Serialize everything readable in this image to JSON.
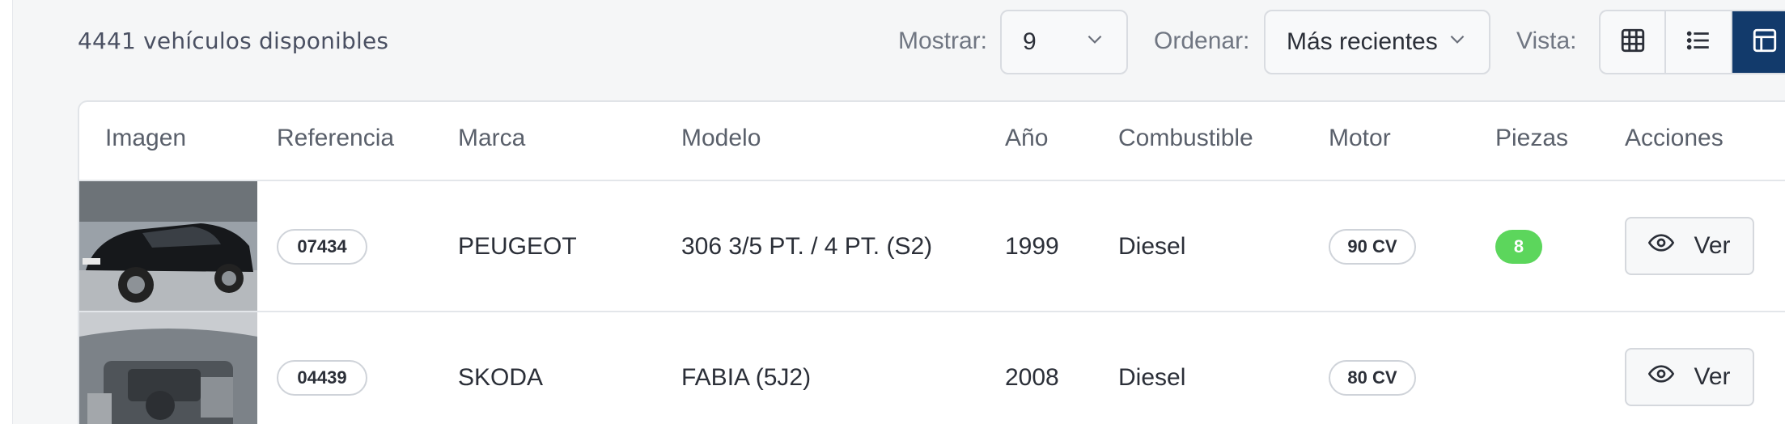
{
  "summary": {
    "count_text": "4441 vehículos disponibles"
  },
  "controls": {
    "show_label": "Mostrar:",
    "show_value": "9",
    "sort_label": "Ordenar:",
    "sort_value": "Más recientes",
    "view_label": "Vista:",
    "view_modes": [
      "grid-icon",
      "list-icon",
      "table-icon"
    ],
    "active_view": "table"
  },
  "table": {
    "headers": [
      "Imagen",
      "Referencia",
      "Marca",
      "Modelo",
      "Año",
      "Combustible",
      "Motor",
      "Piezas",
      "Acciones"
    ],
    "rows": [
      {
        "ref": "07434",
        "brand": "PEUGEOT",
        "model": "306 3/5 PT. / 4 PT. (S2)",
        "year": "1999",
        "fuel": "Diesel",
        "engine": "90 CV",
        "parts": "8",
        "action": "Ver"
      },
      {
        "ref": "04439",
        "brand": "SKODA",
        "model": "FABIA (5J2)",
        "year": "2008",
        "fuel": "Diesel",
        "engine": "80 CV",
        "parts": "",
        "action": "Ver"
      }
    ]
  },
  "colors": {
    "accent": "#123a6b",
    "badge_green": "#5cd65c"
  }
}
